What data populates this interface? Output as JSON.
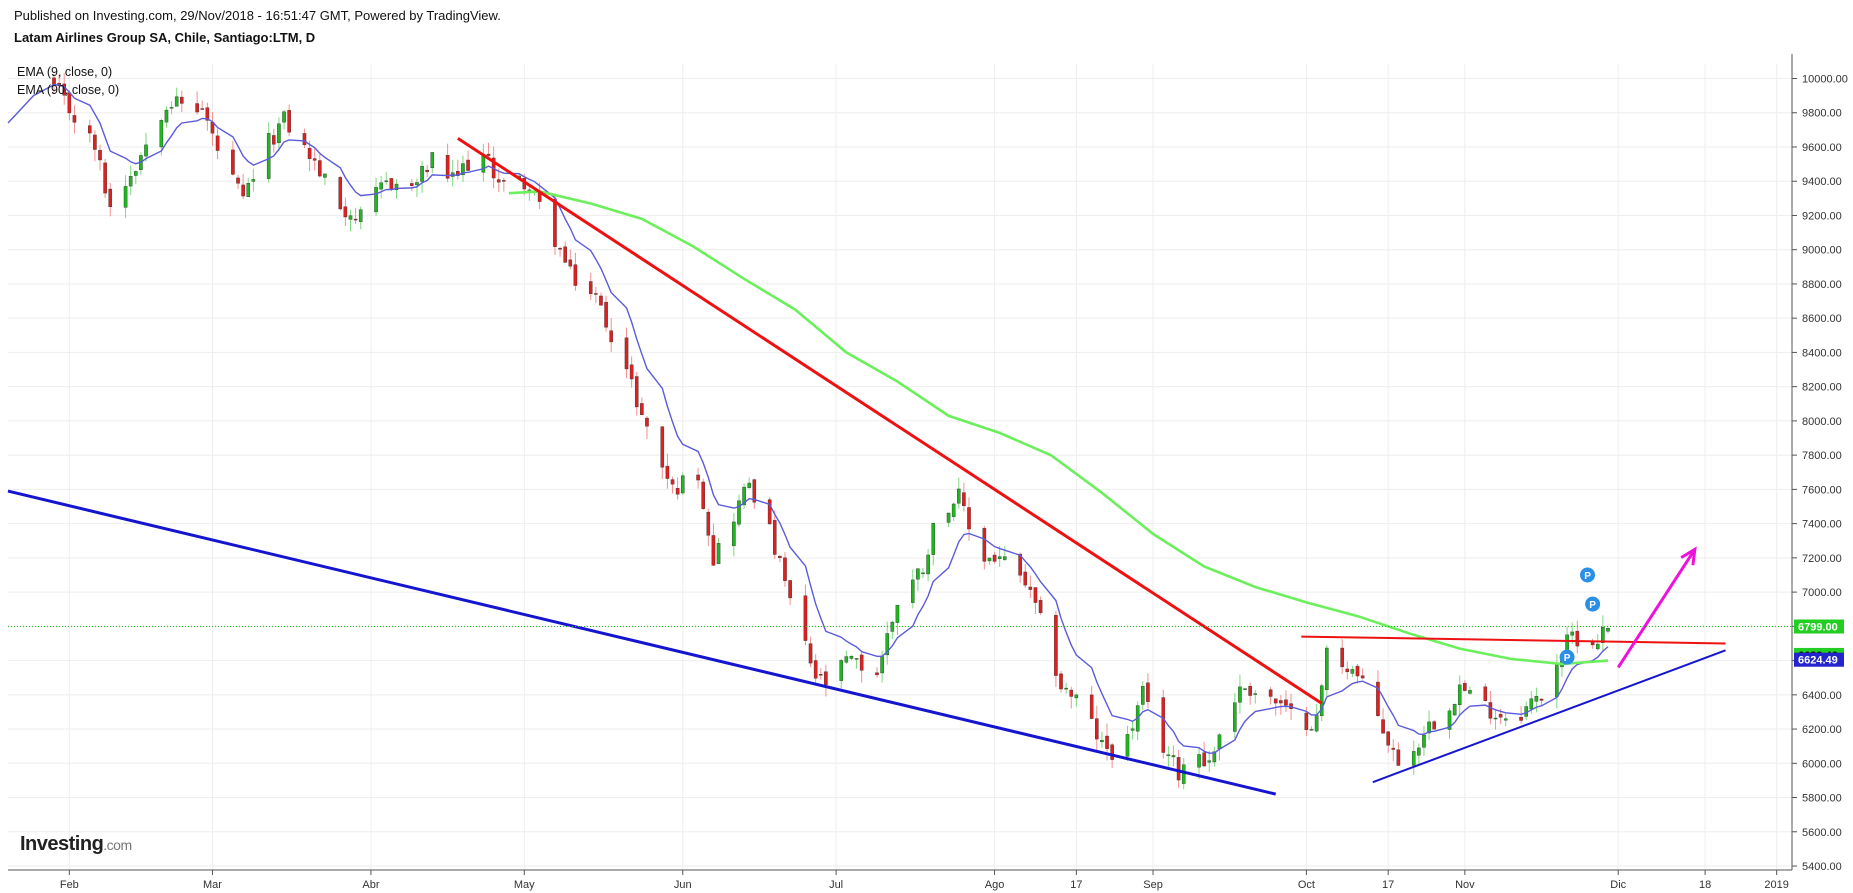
{
  "header": {
    "published": "Published on Investing.com, 29/Nov/2018 - 16:51:47 GMT, Powered by TradingView.",
    "symbol": "Latam Airlines Group SA, Chile, Santiago:LTM, D"
  },
  "indicators": [
    {
      "label": "EMA (9, close, 0)",
      "color": "#5b5bdc"
    },
    {
      "label": "EMA (90, close, 0)",
      "color": "#6cef5c"
    }
  ],
  "logo": {
    "main": "Investing",
    "suffix": ".com"
  },
  "colors": {
    "up": "#1db81d",
    "down": "#e01f1f",
    "ema9": "#5b5bdc",
    "ema90": "#6cef5c",
    "red_trendline": "#ee1111",
    "blue_trendline": "#1515d0",
    "arrow": "#ee11dd",
    "price_line": "#1fb81f"
  },
  "chart_data": {
    "type": "candlestick",
    "y_axis": {
      "min": 5300,
      "max": 10100,
      "ticks": [
        10000,
        9800,
        9600,
        9400,
        9200,
        9000,
        8800,
        8600,
        8400,
        8200,
        8000,
        7800,
        7600,
        7400,
        7200,
        7000,
        6800,
        6600,
        6400,
        6200,
        6000,
        5800,
        5600,
        5400
      ],
      "tick_labels": [
        "10000.00",
        "9800.00",
        "9600.00",
        "9400.00",
        "9200.00",
        "9000.00",
        "8800.00",
        "8600.00",
        "8400.00",
        "8200.00",
        "8000.00",
        "7800.00",
        "7600.00",
        "7400.00",
        "7200.00",
        "7000.00",
        "6800.00",
        "6600.00",
        "6400.00",
        "6200.00",
        "6000.00",
        "5800.00",
        "5600.00",
        "5400.00"
      ],
      "position": "right"
    },
    "x_axis": {
      "start": "2018-01-20",
      "end": "2019-01-04",
      "ticks": [
        {
          "label": "Feb",
          "date": "2018-02-01"
        },
        {
          "label": "Mar",
          "date": "2018-03-01"
        },
        {
          "label": "Abr",
          "date": "2018-04-01"
        },
        {
          "label": "May",
          "date": "2018-05-01"
        },
        {
          "label": "Jun",
          "date": "2018-06-01"
        },
        {
          "label": "Jul",
          "date": "2018-07-01"
        },
        {
          "label": "Ago",
          "date": "2018-08-01"
        },
        {
          "label": "17",
          "date": "2018-08-17"
        },
        {
          "label": "Sep",
          "date": "2018-09-01"
        },
        {
          "label": "Oct",
          "date": "2018-10-01"
        },
        {
          "label": "17",
          "date": "2018-10-17"
        },
        {
          "label": "Nov",
          "date": "2018-11-01"
        },
        {
          "label": "Dic",
          "date": "2018-12-01"
        },
        {
          "label": "18",
          "date": "2018-12-18"
        },
        {
          "label": "2019",
          "date": "2019-01-01"
        }
      ]
    },
    "price_path": [
      [
        "2018-01-28",
        9990
      ],
      [
        "2018-02-06",
        9600
      ],
      [
        "2018-02-09",
        9250
      ],
      [
        "2018-02-14",
        9500
      ],
      [
        "2018-02-20",
        9870
      ],
      [
        "2018-02-27",
        9820
      ],
      [
        "2018-03-02",
        9580
      ],
      [
        "2018-03-07",
        9280
      ],
      [
        "2018-03-11",
        9580
      ],
      [
        "2018-03-15",
        9760
      ],
      [
        "2018-03-20",
        9550
      ],
      [
        "2018-03-26",
        9250
      ],
      [
        "2018-03-30",
        9180
      ],
      [
        "2018-04-04",
        9400
      ],
      [
        "2018-04-09",
        9360
      ],
      [
        "2018-04-13",
        9520
      ],
      [
        "2018-04-17",
        9400
      ],
      [
        "2018-04-22",
        9580
      ],
      [
        "2018-04-27",
        9380
      ],
      [
        "2018-05-01",
        9400
      ],
      [
        "2018-05-05",
        9200
      ],
      [
        "2018-05-10",
        8850
      ],
      [
        "2018-05-15",
        8720
      ],
      [
        "2018-05-20",
        8380
      ],
      [
        "2018-05-25",
        7950
      ],
      [
        "2018-05-30",
        7600
      ],
      [
        "2018-06-04",
        7700
      ],
      [
        "2018-06-07",
        7200
      ],
      [
        "2018-06-11",
        7450
      ],
      [
        "2018-06-14",
        7650
      ],
      [
        "2018-06-18",
        7350
      ],
      [
        "2018-06-23",
        6850
      ],
      [
        "2018-06-27",
        6500
      ],
      [
        "2018-06-30",
        6450
      ],
      [
        "2018-07-03",
        6600
      ],
      [
        "2018-07-09",
        6530
      ],
      [
        "2018-07-13",
        6950
      ],
      [
        "2018-07-18",
        7150
      ],
      [
        "2018-07-21",
        7480
      ],
      [
        "2018-07-25",
        7550
      ],
      [
        "2018-07-29",
        7200
      ],
      [
        "2018-08-02",
        7200
      ],
      [
        "2018-08-07",
        7050
      ],
      [
        "2018-08-11",
        6750
      ],
      [
        "2018-08-14",
        6450
      ],
      [
        "2018-08-18",
        6350
      ],
      [
        "2018-08-22",
        6100
      ],
      [
        "2018-08-26",
        6050
      ],
      [
        "2018-08-30",
        6400
      ],
      [
        "2018-09-02",
        6150
      ],
      [
        "2018-09-06",
        5950
      ],
      [
        "2018-09-09",
        6100
      ],
      [
        "2018-09-12",
        6000
      ],
      [
        "2018-09-16",
        6350
      ],
      [
        "2018-09-19",
        6450
      ],
      [
        "2018-09-24",
        6380
      ],
      [
        "2018-09-29",
        6250
      ],
      [
        "2018-10-03",
        6250
      ],
      [
        "2018-10-05",
        6650
      ],
      [
        "2018-10-10",
        6550
      ],
      [
        "2018-10-14",
        6350
      ],
      [
        "2018-10-18",
        6050
      ],
      [
        "2018-10-21",
        5990
      ],
      [
        "2018-10-24",
        6200
      ],
      [
        "2018-10-28",
        6300
      ],
      [
        "2018-10-31",
        6450
      ],
      [
        "2018-11-04",
        6350
      ],
      [
        "2018-11-08",
        6280
      ],
      [
        "2018-11-12",
        6300
      ],
      [
        "2018-11-16",
        6400
      ],
      [
        "2018-11-19",
        6600
      ],
      [
        "2018-11-22",
        6750
      ],
      [
        "2018-11-26",
        6700
      ],
      [
        "2018-11-29",
        6800
      ]
    ],
    "ema_90_path": [
      [
        "2018-04-28",
        9330
      ],
      [
        "2018-05-04",
        9340
      ],
      [
        "2018-05-14",
        9270
      ],
      [
        "2018-05-24",
        9180
      ],
      [
        "2018-06-03",
        9020
      ],
      [
        "2018-06-13",
        8830
      ],
      [
        "2018-06-23",
        8650
      ],
      [
        "2018-07-03",
        8400
      ],
      [
        "2018-07-13",
        8230
      ],
      [
        "2018-07-23",
        8030
      ],
      [
        "2018-08-02",
        7930
      ],
      [
        "2018-08-12",
        7800
      ],
      [
        "2018-08-22",
        7580
      ],
      [
        "2018-09-01",
        7340
      ],
      [
        "2018-09-11",
        7150
      ],
      [
        "2018-09-21",
        7030
      ],
      [
        "2018-10-01",
        6940
      ],
      [
        "2018-10-11",
        6860
      ],
      [
        "2018-10-21",
        6760
      ],
      [
        "2018-10-31",
        6670
      ],
      [
        "2018-11-10",
        6610
      ],
      [
        "2018-11-20",
        6580
      ],
      [
        "2018-11-29",
        6600
      ]
    ],
    "price_lines": [
      {
        "label": "6799.00",
        "value": 6799,
        "bg": "#22ce22",
        "fg": "#ffffff",
        "dotted": true
      },
      {
        "label": "6633.46",
        "value": 6633,
        "bg": "#22ce22",
        "fg": "#111111",
        "dotted": false
      },
      {
        "label": "6624.49",
        "value": 6605,
        "bg": "#2424cc",
        "fg": "#ffffff",
        "dotted": false
      }
    ],
    "trendlines": [
      {
        "name": "red-downtrend",
        "color": "#ee1111",
        "width": 3,
        "from": [
          "2018-04-18",
          9650
        ],
        "to": [
          "2018-10-04",
          6350
        ]
      },
      {
        "name": "red-horizontal",
        "color": "#ee1111",
        "width": 2,
        "from": [
          "2018-09-30",
          6740
        ],
        "to": [
          "2018-12-22",
          6700
        ]
      },
      {
        "name": "blue-wedge",
        "color": "#1515d0",
        "width": 3,
        "from": [
          "2018-01-20",
          7590
        ],
        "to": [
          "2018-09-25",
          5820
        ]
      },
      {
        "name": "blue-uptrend",
        "color": "#1515d0",
        "width": 2,
        "from": [
          "2018-10-14",
          5890
        ],
        "to": [
          "2018-12-22",
          6660
        ]
      }
    ],
    "arrow": {
      "color": "#ee11dd",
      "from": [
        "2018-12-01",
        6560
      ],
      "to": [
        "2018-12-16",
        7250
      ]
    },
    "markers": [
      {
        "label": "P",
        "date": "2018-11-25",
        "value": 7100
      },
      {
        "label": "P",
        "date": "2018-11-26",
        "value": 6930
      },
      {
        "label": "P",
        "date": "2018-11-21",
        "value": 6620
      }
    ]
  }
}
